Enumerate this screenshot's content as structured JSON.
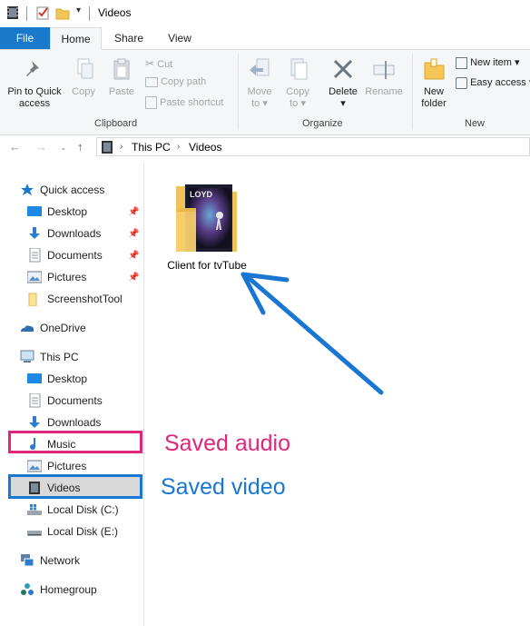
{
  "window": {
    "title": "Videos"
  },
  "ribbon_tabs": [
    "File",
    "Home",
    "Share",
    "View"
  ],
  "clipboard": {
    "pin_label_1": "Pin to Quick",
    "pin_label_2": "access",
    "copy": "Copy",
    "paste": "Paste",
    "cut": "Cut",
    "copy_path": "Copy path",
    "paste_shortcut": "Paste shortcut",
    "group": "Clipboard"
  },
  "organize": {
    "move_to_1": "Move",
    "move_to_2": "to",
    "copy_to_1": "Copy",
    "copy_to_2": "to",
    "delete": "Delete",
    "rename": "Rename",
    "group": "Organize"
  },
  "new": {
    "new_folder_1": "New",
    "new_folder_2": "folder",
    "new_item": "New item",
    "easy_access": "Easy access",
    "group": "New"
  },
  "address": {
    "crumbs": [
      "This PC",
      "Videos"
    ]
  },
  "sidebar": {
    "quick_access": "Quick access",
    "quick_items": [
      "Desktop",
      "Downloads",
      "Documents",
      "Pictures",
      "ScreenshotTool"
    ],
    "onedrive": "OneDrive",
    "this_pc": "This PC",
    "pc_items": [
      "Desktop",
      "Documents",
      "Downloads",
      "Music",
      "Pictures",
      "Videos",
      "Local Disk (C:)",
      "Local Disk (E:)"
    ],
    "network": "Network",
    "homegroup": "Homegroup"
  },
  "content": {
    "items": [
      {
        "name": "Client for tvTube",
        "thumb_text": "LOYD"
      }
    ]
  },
  "annotations": {
    "music": "Saved audio",
    "video": "Saved video",
    "music_color": "#e0277a",
    "video_color": "#1976d2"
  },
  "colors": {
    "accent": "#1979ca",
    "selected": "#cce8ff"
  }
}
